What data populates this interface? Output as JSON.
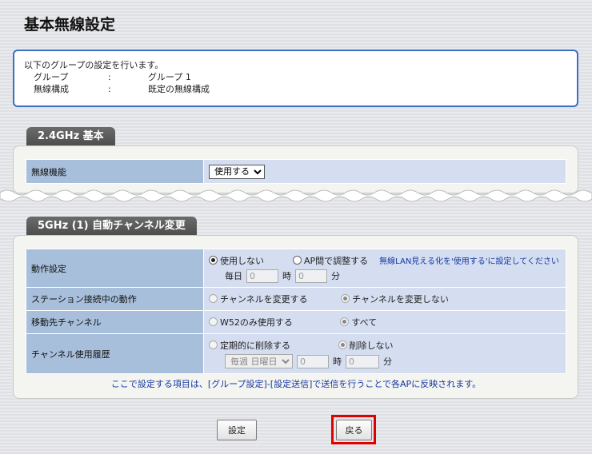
{
  "page": {
    "title": "基本無線設定"
  },
  "info": {
    "intro": "以下のグループの設定を行います。",
    "rows": [
      {
        "key": "グループ",
        "sep": ":",
        "value": "グループ 1"
      },
      {
        "key": "無線構成",
        "sep": ":",
        "value": "既定の無線構成"
      }
    ]
  },
  "section_24": {
    "tab": "2.4GHz 基本",
    "wireless_label": "無線機能",
    "wireless_value": "使用する"
  },
  "section_5": {
    "tab": "5GHz (1) 自動チャンネル変更",
    "operation": {
      "label": "動作設定",
      "opt1": "使用しない",
      "opt2": "AP間で調整する",
      "note": "無線LAN見える化を'使用する'に設定してください",
      "daily": "毎日",
      "hour_value": "0",
      "hour_unit": "時",
      "min_value": "0",
      "min_unit": "分"
    },
    "station": {
      "label": "ステーション接続中の動作",
      "opt1": "チャンネルを変更する",
      "opt2": "チャンネルを変更しない"
    },
    "dest": {
      "label": "移動先チャンネル",
      "opt1": "W52のみ使用する",
      "opt2": "すべて"
    },
    "history": {
      "label": "チャンネル使用履歴",
      "opt1": "定期的に削除する",
      "opt2": "削除しない",
      "weekly": "毎週 日曜日",
      "hour_value": "0",
      "hour_unit": "時",
      "min_value": "0",
      "min_unit": "分"
    }
  },
  "footer": {
    "note": "ここで設定する項目は、[グループ設定]-[設定送信]で送信を行うことで各APに反映されます。",
    "set_label": "設定",
    "back_label": "戻る"
  }
}
